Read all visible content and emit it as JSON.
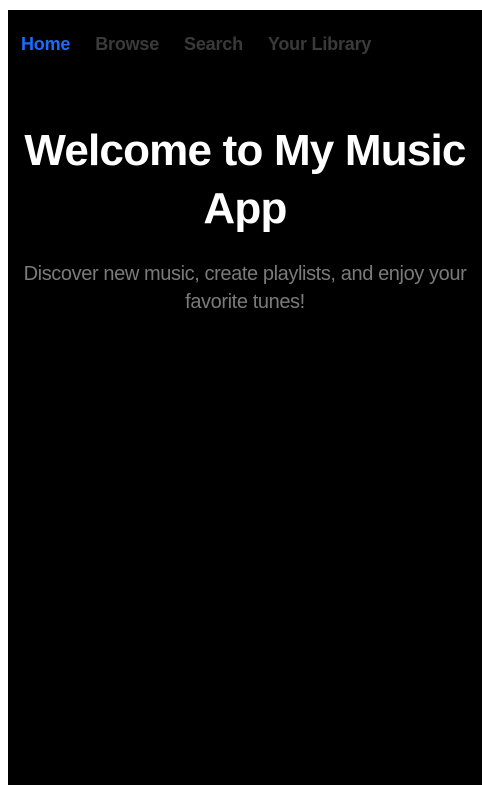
{
  "nav": {
    "items": [
      {
        "label": "Home",
        "active": true
      },
      {
        "label": "Browse",
        "active": false
      },
      {
        "label": "Search",
        "active": false
      },
      {
        "label": "Your Library",
        "active": false
      }
    ]
  },
  "hero": {
    "title": "Welcome to My Music App",
    "subtitle": "Discover new music, create playlists, and enjoy your favorite tunes!"
  },
  "colors": {
    "background": "#000000",
    "accent": "#1a6cff",
    "nav_inactive": "#3a3a3a",
    "title": "#ffffff",
    "subtitle": "#7a7a7a"
  }
}
